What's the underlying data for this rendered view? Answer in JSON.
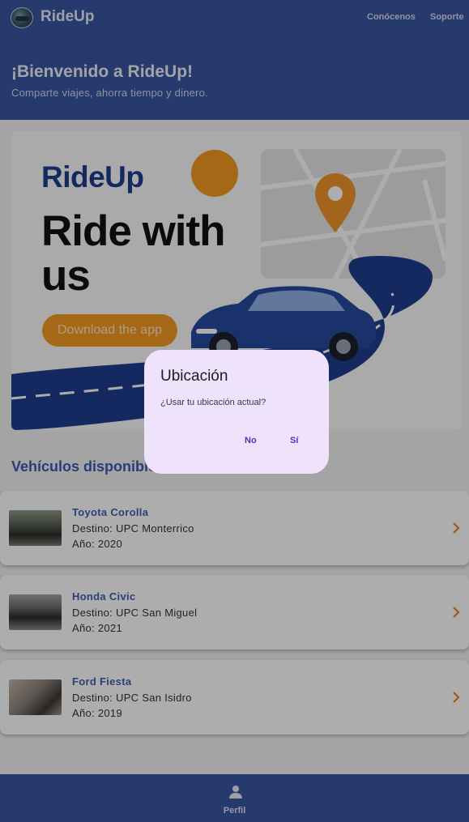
{
  "header": {
    "brand": "RideUp",
    "nav": [
      "Conócenos",
      "Soporte"
    ]
  },
  "hero": {
    "title": "¡Bienvenido a RideUp!",
    "subtitle": "Comparte viajes, ahorra tiempo y dinero."
  },
  "banner": {
    "logo_text": "RideUp",
    "headline": "Ride with us",
    "cta": "Download the app",
    "accent_color": "#f49a21",
    "brand_color": "#1f3d8f"
  },
  "vehicles": {
    "section_title": "Vehículos disponibles",
    "items": [
      {
        "name": "Toyota Corolla",
        "destination": "Destino: UPC Monterrico",
        "year": "Año: 2020"
      },
      {
        "name": "Honda Civic",
        "destination": "Destino: UPC San Miguel",
        "year": "Año: 2021"
      },
      {
        "name": "Ford Fiesta",
        "destination": "Destino: UPC San Isidro",
        "year": "Año: 2019"
      }
    ]
  },
  "bottom_nav": {
    "label": "Perfil",
    "icon": "person-icon"
  },
  "dialog": {
    "title": "Ubicación",
    "message": "¿Usar tu ubicación actual?",
    "no_label": "No",
    "yes_label": "Sí"
  },
  "colors": {
    "primary": "#3a56a3",
    "chevron": "#e8871a",
    "dialog_bg": "#efe2fb",
    "dialog_action": "#5a2dbd"
  }
}
